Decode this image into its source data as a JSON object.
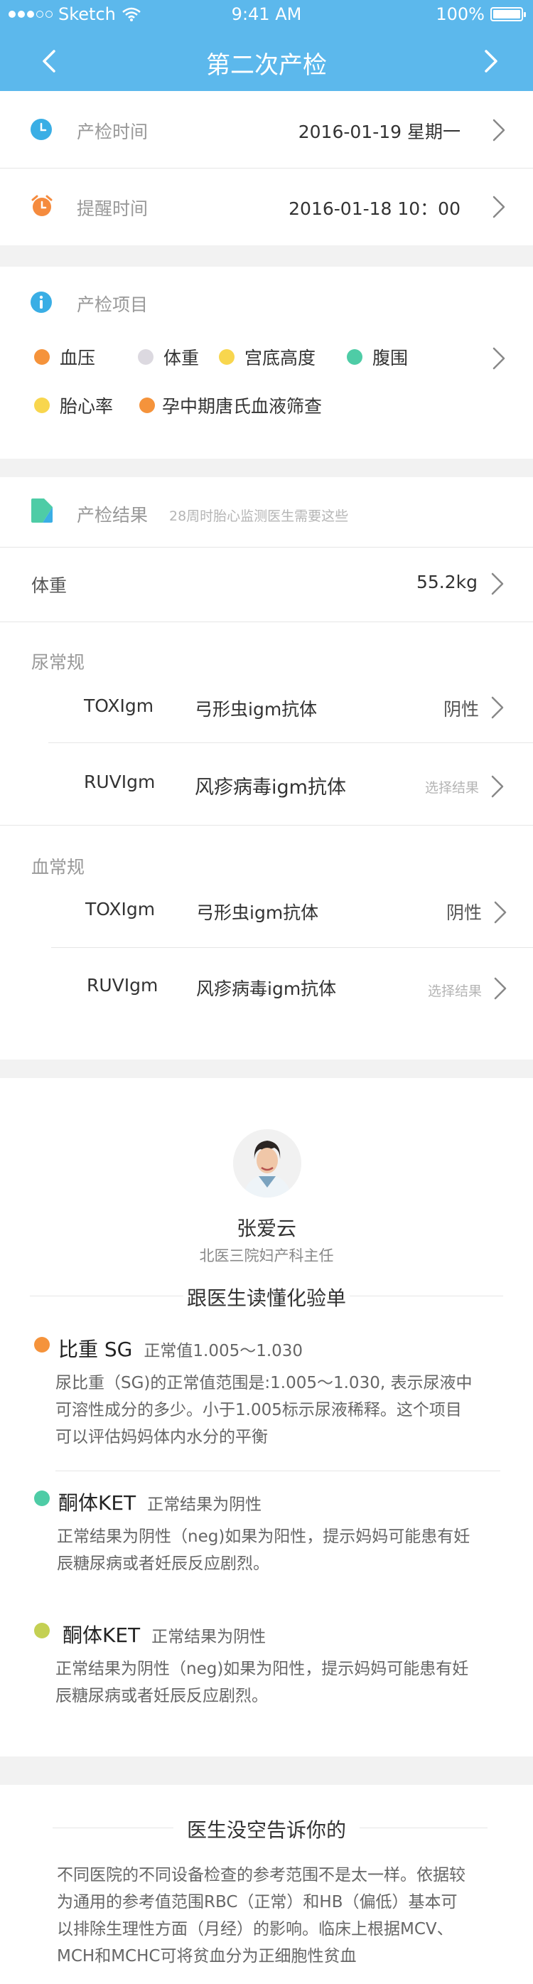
{
  "status_bar": {
    "carrier": "Sketch",
    "time": "9:41 AM",
    "battery": "100%"
  },
  "nav": {
    "title": "第二次产检"
  },
  "schedule": {
    "exam_time": {
      "label": "产检时间",
      "value": "2016-01-19 星期一"
    },
    "reminder_time": {
      "label": "提醒时间",
      "value": "2016-01-18 10：00"
    }
  },
  "items": {
    "label": "产检项目",
    "tags": [
      {
        "text": "血压",
        "color": "#f5933b"
      },
      {
        "text": "体重",
        "color": "#dcd9e0"
      },
      {
        "text": "宫底高度",
        "color": "#f8d64e"
      },
      {
        "text": "腹围",
        "color": "#4ecca6"
      },
      {
        "text": "胎心率",
        "color": "#f8d64e"
      },
      {
        "text": "孕中期唐氏血液筛查",
        "color": "#f5933b"
      }
    ]
  },
  "results": {
    "label": "产检结果",
    "hint": "28周时胎心监测医生需要这些",
    "weight": {
      "label": "体重",
      "value": "55.2kg"
    },
    "urine": {
      "header": "尿常规",
      "rows": [
        {
          "code": "TOXIgm",
          "name": "弓形虫igm抗体",
          "result": "阴性",
          "muted": false
        },
        {
          "code": "RUVIgm",
          "name": "风疹病毒igm抗体",
          "result": "选择结果",
          "muted": true
        }
      ]
    },
    "blood": {
      "header": "血常规",
      "rows": [
        {
          "code": "TOXIgm",
          "name": "弓形虫igm抗体",
          "result": "阴性",
          "muted": false
        },
        {
          "code": "RUVIgm",
          "name": "风疹病毒igm抗体",
          "result": "选择结果",
          "muted": true
        }
      ]
    }
  },
  "doctor": {
    "name": "张爱云",
    "title": "北医三院妇产科主任",
    "section_title": "跟医生读懂化验单",
    "items": [
      {
        "title": "比重 SG",
        "normal": "正常值1.005～1.030",
        "color": "#f5933b",
        "lines": [
          "尿比重（SG)的正常值范围是:1.005～1.030, 表示尿液中",
          "可溶性成分的多少。小于1.005标示尿液稀释。这个项目",
          "可以评估妈妈体内水分的平衡"
        ]
      },
      {
        "title": "酮体KET",
        "normal": "正常结果为阴性",
        "color": "#4ecca6",
        "lines": [
          "正常结果为阴性（neg)如果为阳性，提示妈妈可能患有妊",
          "辰糖尿病或者妊辰反应剧烈。"
        ]
      },
      {
        "title": "酮体KET",
        "normal": "正常结果为阴性",
        "color": "#c4d053",
        "lines": [
          "正常结果为阴性（neg)如果为阳性，提示妈妈可能患有妊",
          "辰糖尿病或者妊辰反应剧烈。"
        ]
      }
    ]
  },
  "note": {
    "title": "医生没空告诉你的",
    "lines": [
      "不同医院的不同设备检查的参考范围不是太一样。依据较",
      "为通用的参考值范围RBC（正常）和HB（偏低）基本可",
      "以排除生理性方面（月经）的影响。临床上根据MCV、",
      "MCH和MCHC可将贫血分为正细胞性贫血"
    ]
  },
  "colors": {
    "accent": "#5cb8ec",
    "orange": "#f5933b",
    "teal": "#4ecca6",
    "yellow": "#f8d64e"
  }
}
